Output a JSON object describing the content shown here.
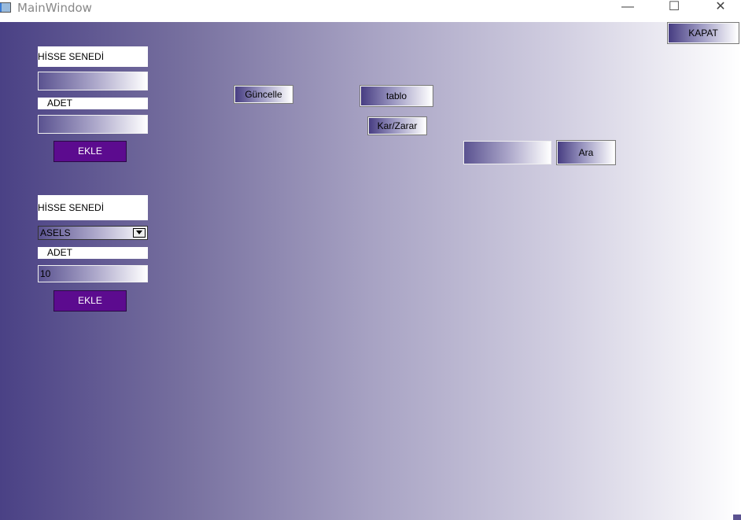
{
  "window": {
    "title": "MainWindow",
    "minimize_glyph": "—",
    "maximize_glyph": "☐",
    "close_glyph": "✕"
  },
  "top_right": {
    "kapat_label": "KAPAT"
  },
  "form1": {
    "stock_label": "HİSSE SENEDİ",
    "stock_value": "",
    "qty_label": "ADET",
    "qty_value": "",
    "add_label": "EKLE"
  },
  "form2": {
    "stock_label": "HİSSE SENEDİ",
    "stock_selected": "ASELS",
    "qty_label": "ADET",
    "qty_value": "10",
    "add_label": "EKLE"
  },
  "actions": {
    "update_label": "Güncelle",
    "table_label": "tablo",
    "profit_loss_label": "Kar/Zarar",
    "search_value": "",
    "search_label": "Ara"
  },
  "colors": {
    "gradient_start": "#4a4185",
    "gradient_end": "#ffffff",
    "add_button": "#5c0b8f"
  }
}
